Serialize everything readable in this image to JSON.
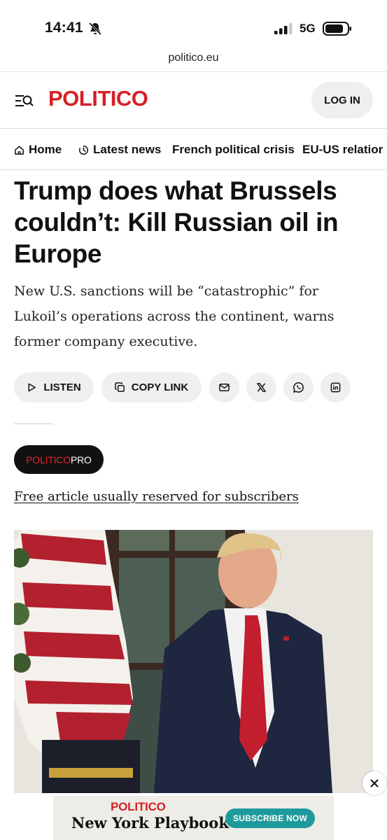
{
  "status_bar": {
    "time": "14:41",
    "network": "5G"
  },
  "browser": {
    "url": "politico.eu"
  },
  "header": {
    "logo": "POLITICO",
    "login_label": "LOG IN"
  },
  "nav": {
    "items": [
      {
        "label": "Home",
        "icon": "home-icon"
      },
      {
        "label": "Latest news",
        "icon": "clock-icon"
      },
      {
        "label": "French political crisis",
        "icon": ""
      },
      {
        "label": "EU-US relatior",
        "icon": ""
      }
    ]
  },
  "article": {
    "headline": "Trump does what Brussels couldn’t: Kill Russian oil in Europe",
    "dek": "New U.S. sanctions will be “catastrophic” for Lukoil’s operations across the continent, warns former company executive.",
    "actions": {
      "listen_label": "LISTEN",
      "copy_link_label": "COPY LINK",
      "share_icons": [
        "mail-icon",
        "x-icon",
        "whatsapp-icon",
        "linkedin-icon"
      ]
    },
    "badge": {
      "politico": "POLITICO",
      "pro": "PRO"
    },
    "free_notice": "Free article usually reserved for subscribers"
  },
  "ad": {
    "brand": "POLITICO",
    "title": "New York Playbook",
    "cta": "SUBSCRIBE NOW"
  },
  "colors": {
    "brand_red": "#d61f26",
    "ad_teal": "#1f9a9c",
    "pill_bg": "#efefef"
  }
}
